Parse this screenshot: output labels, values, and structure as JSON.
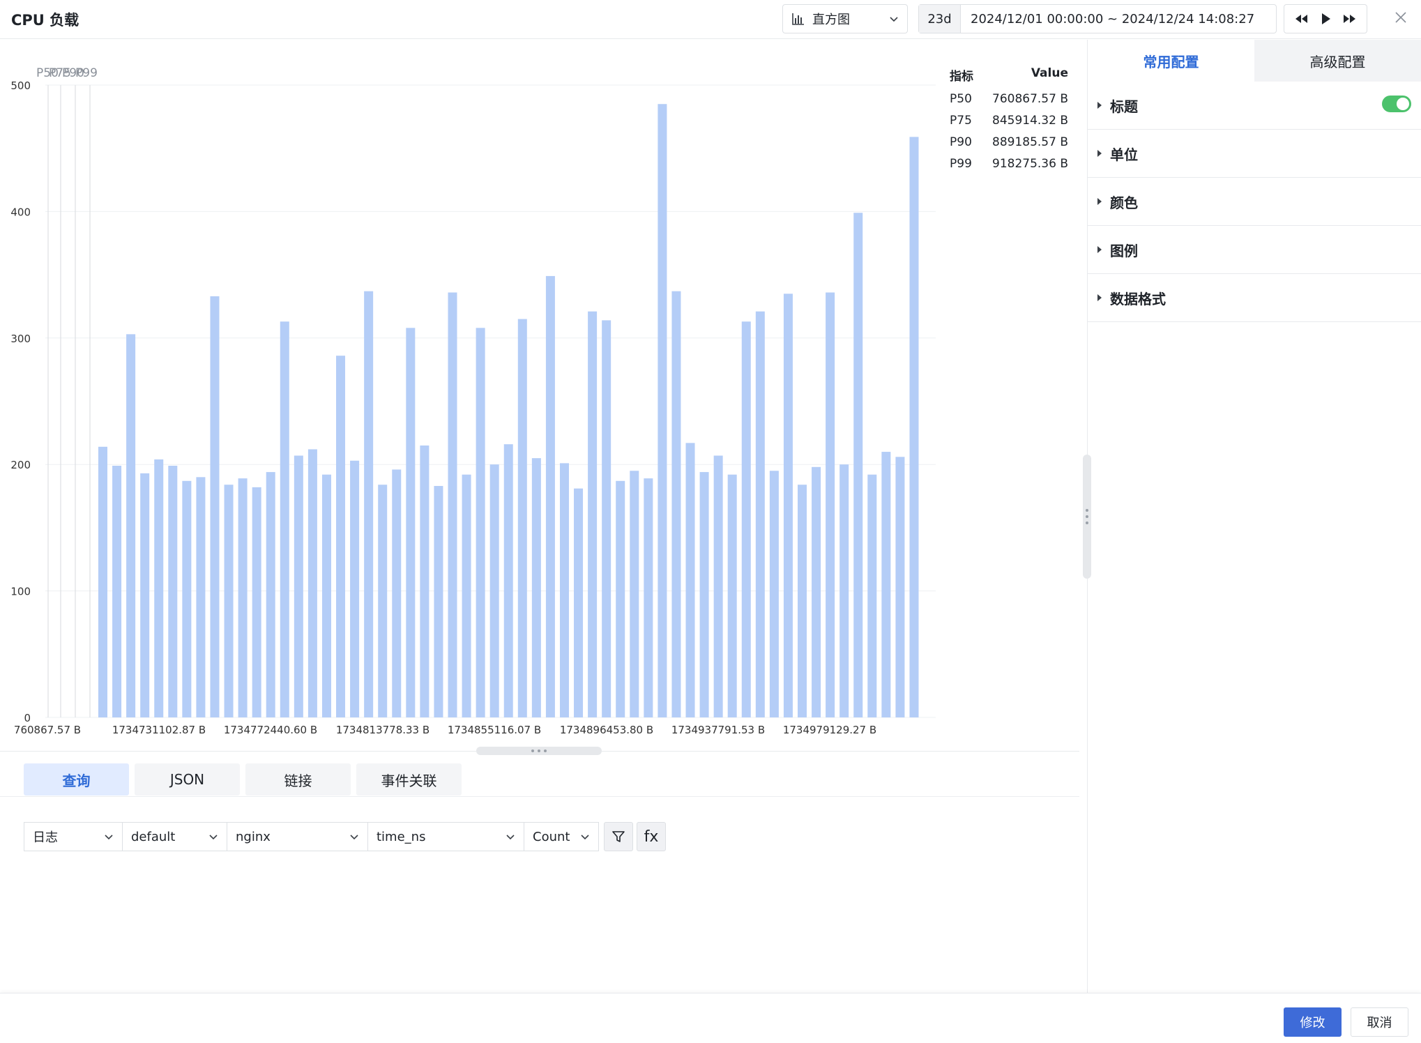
{
  "header": {
    "title": "CPU 负载",
    "chart_type": {
      "label": "直方图",
      "icon": "histogram-icon"
    },
    "time_range": {
      "duration": "23d",
      "range": "2024/12/01 00:00:00 ~ 2024/12/24 14:08:27"
    },
    "player": {
      "rewind_icon": "rewind-icon",
      "play_icon": "play-icon",
      "forward_icon": "fast-forward-icon"
    },
    "close_icon": "close-icon"
  },
  "legend_table": {
    "col_metric": "指标",
    "col_value": "Value",
    "rows": [
      {
        "metric": "P50",
        "value": "760867.57 B"
      },
      {
        "metric": "P75",
        "value": "845914.32 B"
      },
      {
        "metric": "P90",
        "value": "889185.57 B"
      },
      {
        "metric": "P99",
        "value": "918275.36 B"
      }
    ]
  },
  "chart_data": {
    "type": "bar",
    "bar_color": "#b4cdf7",
    "ylim": [
      0,
      500
    ],
    "y_ticks": [
      0,
      100,
      200,
      300,
      400,
      500
    ],
    "x_tick_labels": [
      "760867.57 B",
      "1734731102.87 B",
      "1734772440.60 B",
      "1734813778.33 B",
      "1734855116.07 B",
      "1734896453.80 B",
      "1734937791.53 B",
      "1734979129.27 B"
    ],
    "marker_labels": [
      "P50",
      "P75",
      "P90",
      "P99"
    ],
    "values": [
      214,
      199,
      303,
      193,
      204,
      199,
      187,
      190,
      333,
      184,
      189,
      182,
      194,
      313,
      207,
      212,
      192,
      286,
      203,
      337,
      184,
      196,
      308,
      215,
      183,
      336,
      192,
      308,
      200,
      216,
      315,
      205,
      349,
      201,
      181,
      321,
      314,
      187,
      195,
      189,
      485,
      337,
      217,
      194,
      207,
      192,
      313,
      321,
      195,
      335,
      184,
      198,
      336,
      200,
      399,
      192,
      210,
      206,
      459
    ]
  },
  "query": {
    "tabs": [
      {
        "label": "查询",
        "active": true
      },
      {
        "label": "JSON",
        "active": false
      },
      {
        "label": "链接",
        "active": false
      },
      {
        "label": "事件关联",
        "active": false
      }
    ],
    "selects": [
      {
        "value": "日志"
      },
      {
        "value": "default"
      },
      {
        "value": "nginx"
      },
      {
        "value": "time_ns"
      },
      {
        "value": "Count"
      }
    ],
    "filter_icon": "filter-icon",
    "fx_label": "fx"
  },
  "config": {
    "tabs": [
      {
        "label": "常用配置",
        "active": true
      },
      {
        "label": "高级配置",
        "active": false
      }
    ],
    "items": [
      {
        "label": "标题",
        "toggle_on": true
      },
      {
        "label": "单位"
      },
      {
        "label": "颜色"
      },
      {
        "label": "图例"
      },
      {
        "label": "数据格式"
      }
    ],
    "accent_color": "#2f6bd7",
    "toggle_color": "#4cc26c"
  },
  "footer": {
    "confirm_label": "修改",
    "cancel_label": "取消"
  }
}
